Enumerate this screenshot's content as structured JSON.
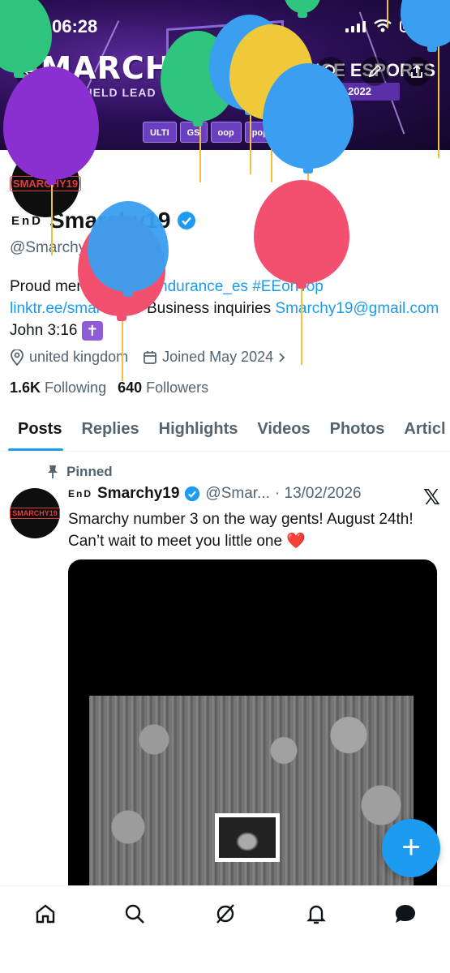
{
  "status_bar": {
    "time": "06:28"
  },
  "banner": {
    "left_title": "SMARCHY",
    "left_subtitle": "BATTLEFIELD LEAD",
    "right_title": "UUNCE ESPORTS",
    "right_subtitle": "EST. 2022",
    "sponsors": [
      "ULTI",
      "GS",
      "oop",
      "poptart"
    ]
  },
  "profile": {
    "avatar_text": "SMARCHY19",
    "name_prefix": "EnD",
    "display_name": "Smarchy19",
    "handle": "@Smarchy19",
    "bio": {
      "text_1": "Proud member of ",
      "link_1": "@Endurance_es",
      "text_2": " ",
      "link_2": "#EEonTop",
      "text_3": " ",
      "link_3": "linktr.ee/smarchy19",
      "text_4": " Business inquiries ",
      "link_4": "Smarchy19@gmail.com",
      "text_5": " John 3:16 "
    },
    "location": "united kingdom",
    "joined": "Joined May 2024",
    "following_count": "1.6K",
    "following_label": "Following",
    "followers_count": "640",
    "followers_label": "Followers"
  },
  "tabs": [
    "Posts",
    "Replies",
    "Highlights",
    "Videos",
    "Photos",
    "Articl"
  ],
  "post": {
    "pinned_label": "Pinned",
    "avatar_text": "SMARCHY19",
    "name_prefix": "EnD",
    "author": "Smarchy19",
    "handle": "@Smar...",
    "date": "· 13/02/2026",
    "text": "Smarchy number 3 on the way gents! August 24th! Can’t wait to meet you little one ❤️"
  },
  "fab": {
    "label": "+"
  },
  "colors": {
    "accent": "#1d9bf0",
    "banner": "#2a0f55"
  }
}
